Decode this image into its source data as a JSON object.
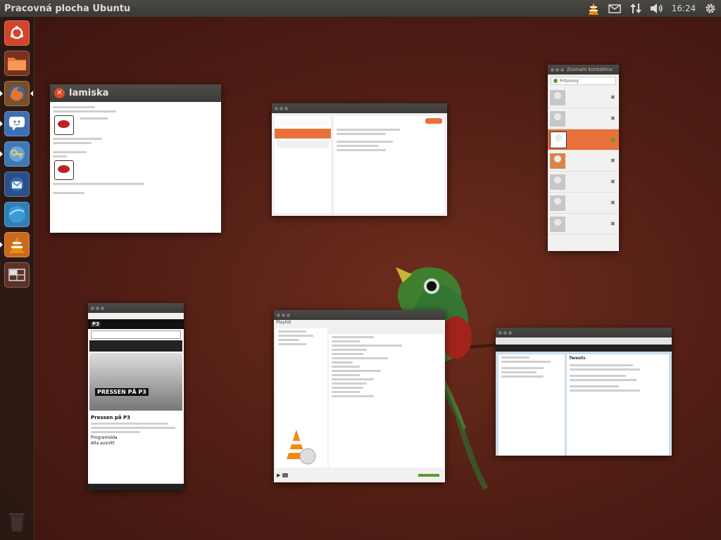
{
  "panel": {
    "title": "Pracovná plocha Ubuntu",
    "clock": "16:24",
    "indicators": [
      "vlc-icon",
      "mail-icon",
      "network-icon",
      "volume-icon",
      "gear-icon"
    ]
  },
  "launcher": {
    "items": [
      "ubuntu-dash-icon",
      "files-icon",
      "firefox-icon",
      "empathy-icon",
      "key-manager-icon",
      "thunderbird-icon",
      "browser-icon",
      "vlc-icon",
      "workspace-switcher-icon"
    ],
    "trash": "trash-icon"
  },
  "windows": {
    "lamiska": {
      "title": "lamiska"
    },
    "contacts": {
      "title": "Zoznam kontaktov",
      "status": "Prítomný",
      "accent": "#e9703a"
    },
    "radio": {
      "badge": "P3",
      "banner": "PRESSEN PÅ P3",
      "program_title": "Pressen på P3",
      "links": [
        "Programsida",
        "Alla avsnitt"
      ]
    },
    "vlc": {
      "menu": "Playlist",
      "title": "VLC"
    },
    "twitter": {
      "title": "Tweets"
    }
  }
}
